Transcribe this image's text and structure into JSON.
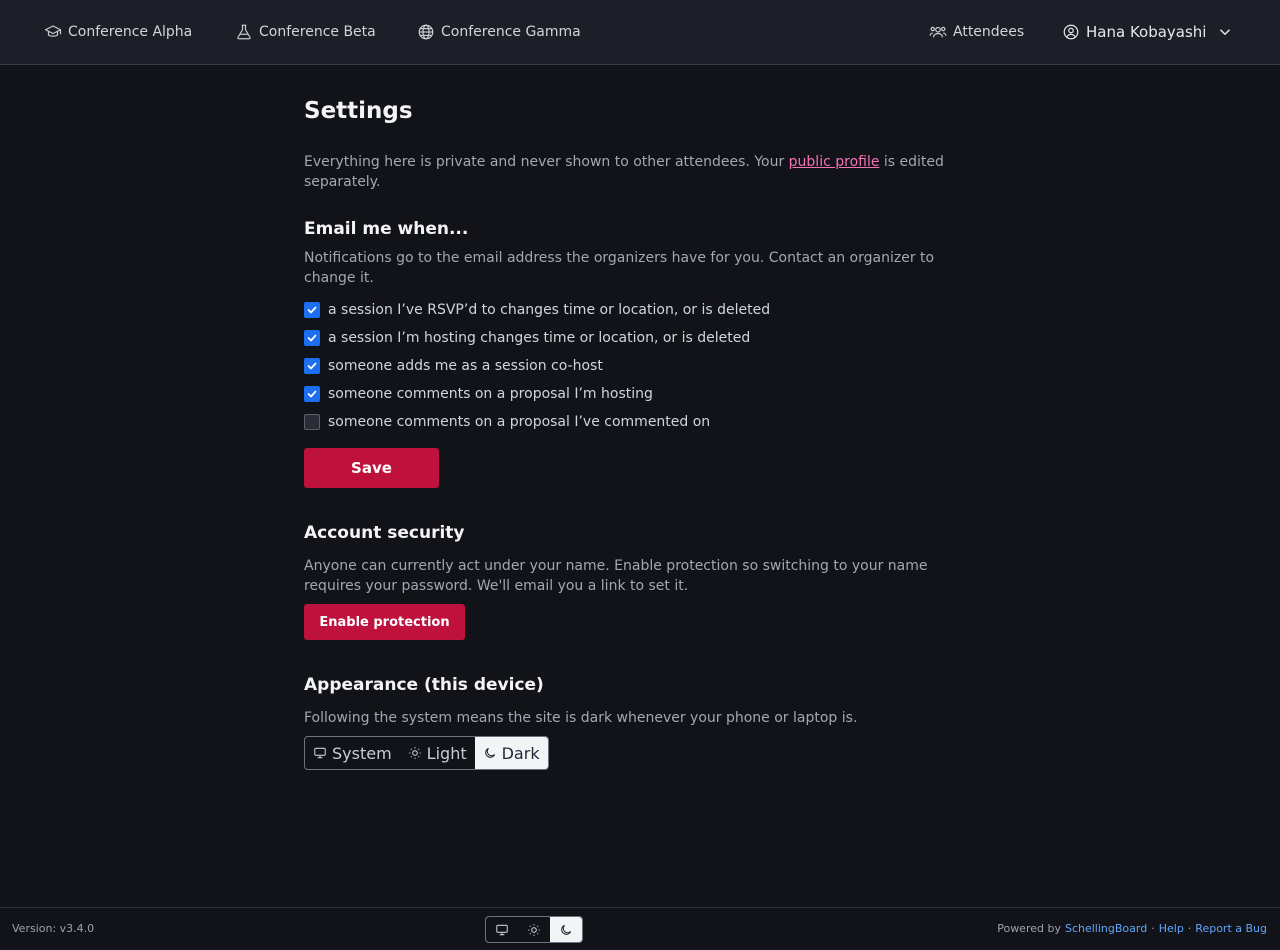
{
  "nav": {
    "conferences": [
      {
        "label": "Conference Alpha",
        "icon": "graduation-cap-icon"
      },
      {
        "label": "Conference Beta",
        "icon": "flask-icon"
      },
      {
        "label": "Conference Gamma",
        "icon": "globe-icon"
      }
    ],
    "attendees_label": "Attendees",
    "user_name": "Hana Kobayashi"
  },
  "settings": {
    "title": "Settings",
    "intro_before": "Everything here is private and never shown to other attendees. Your ",
    "intro_link": "public profile",
    "intro_after": " is edited separately."
  },
  "email": {
    "heading": "Email me when...",
    "description": "Notifications go to the email address the organizers have for you. Contact an organizer to change it.",
    "options": [
      {
        "label": "a session I’ve RSVP’d to changes time or location, or is deleted",
        "checked": true
      },
      {
        "label": "a session I’m hosting changes time or location, or is deleted",
        "checked": true
      },
      {
        "label": "someone adds me as a session co-host",
        "checked": true
      },
      {
        "label": "someone comments on a proposal I’m hosting",
        "checked": true
      },
      {
        "label": "someone comments on a proposal I’ve commented on",
        "checked": false
      }
    ],
    "save_label": "Save"
  },
  "security": {
    "heading": "Account security",
    "description": "Anyone can currently act under your name. Enable protection so switching to your name requires your password. We'll email you a link to set it.",
    "button_label": "Enable protection"
  },
  "appearance": {
    "heading": "Appearance (this device)",
    "description": "Following the system means the site is dark whenever your phone or laptop is.",
    "options": [
      "System",
      "Light",
      "Dark"
    ],
    "selected": "Dark"
  },
  "footer": {
    "version": "Version: v3.4.0",
    "powered_by": "Powered by",
    "brand": "SchellingBoard",
    "sep1": "·",
    "help": "Help",
    "sep2": "·",
    "report": "Report a Bug"
  },
  "colors": {
    "accent": "#be123c",
    "checkbox": "#1d6ff2",
    "link": "#f472b6",
    "background": "#121318"
  }
}
